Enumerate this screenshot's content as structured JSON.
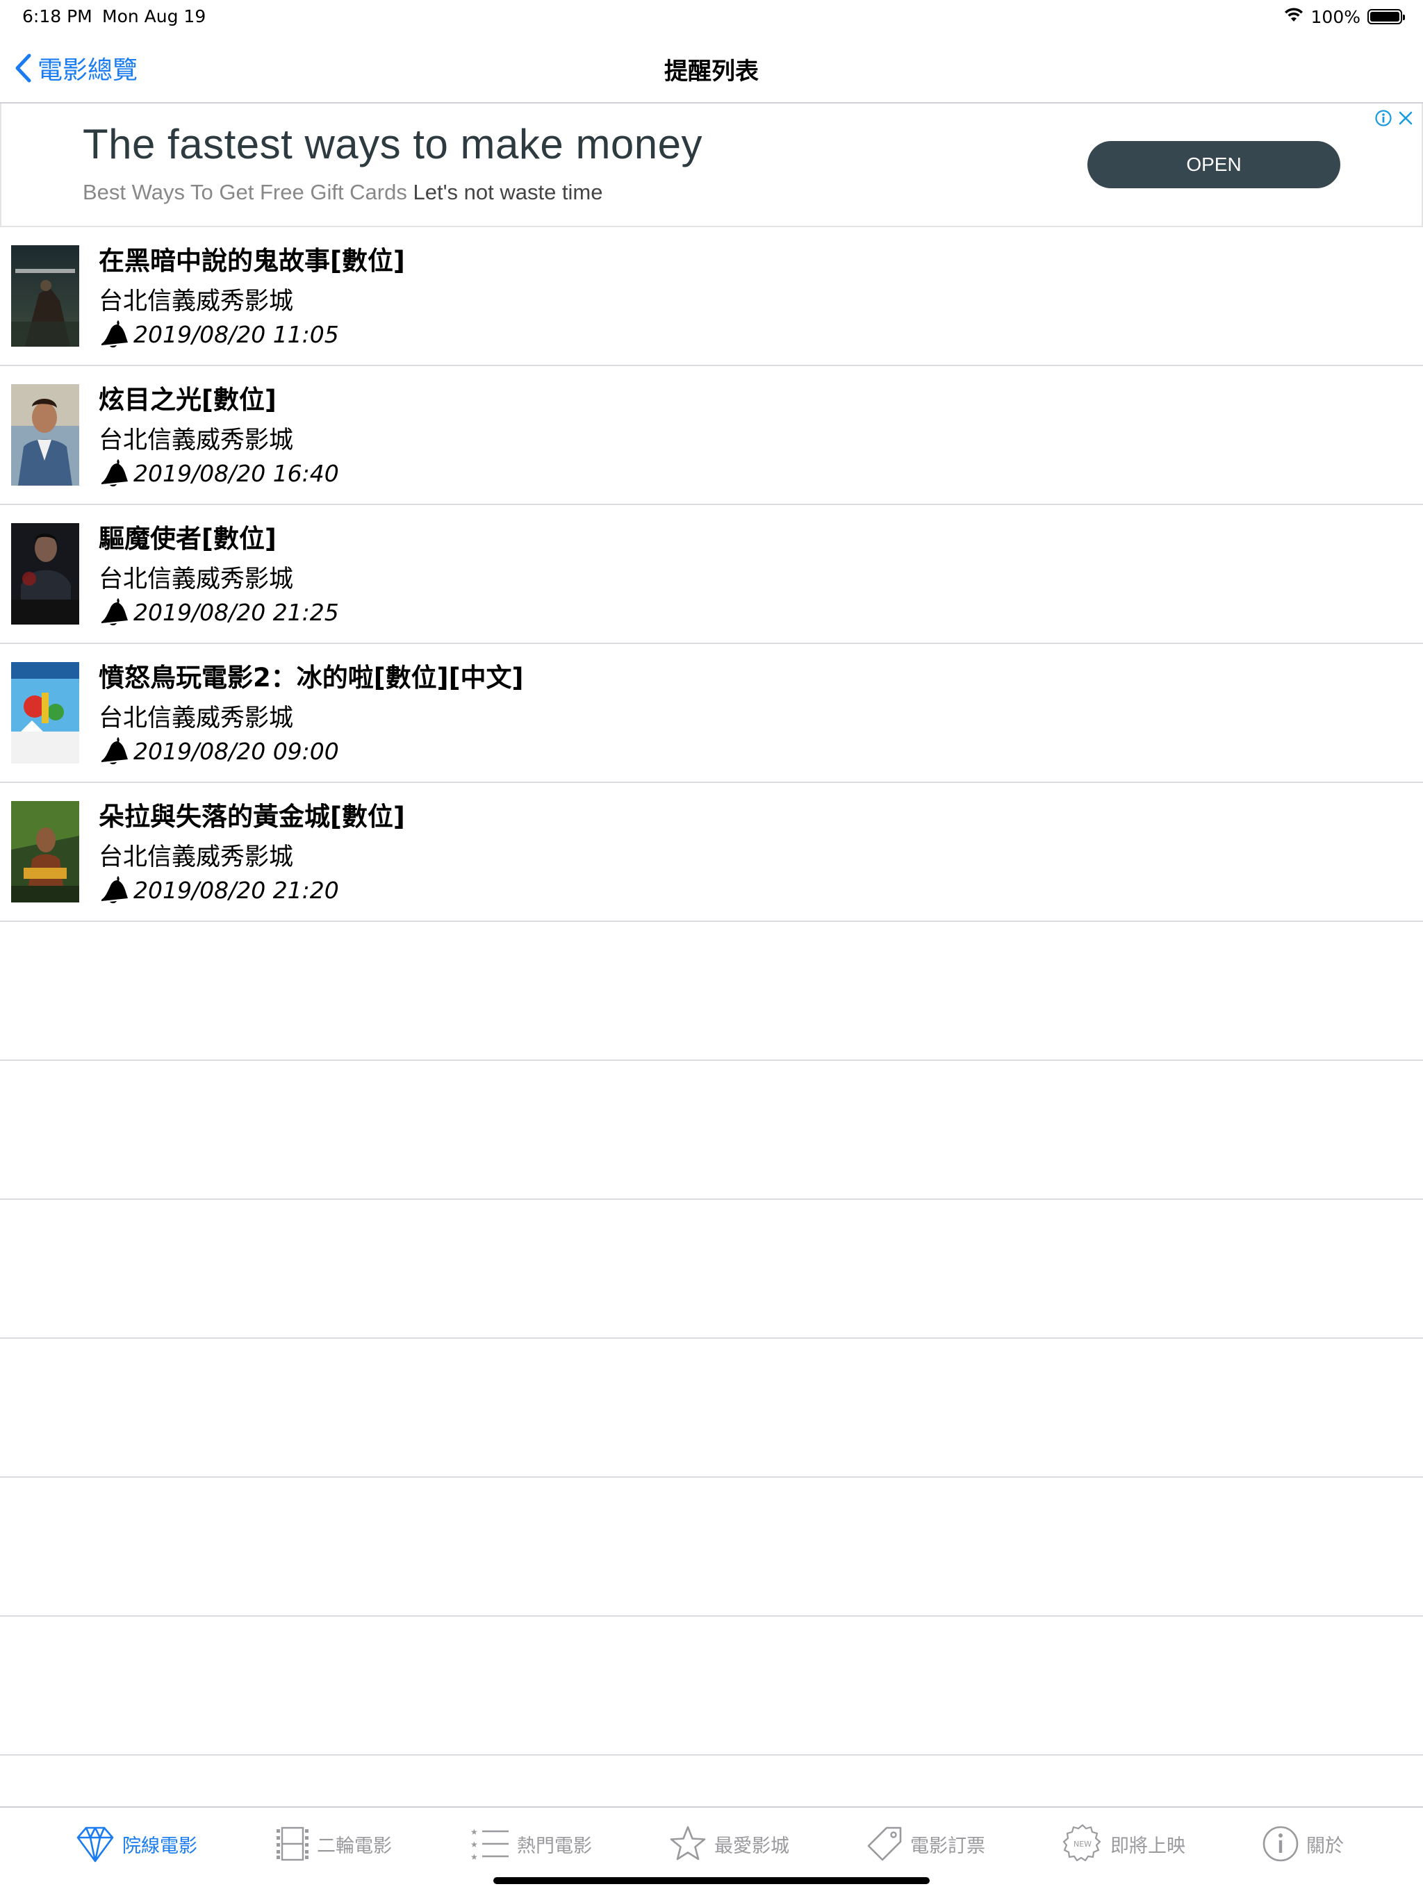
{
  "status_bar": {
    "time": "6:18 PM",
    "date": "Mon Aug 19",
    "battery": "100%"
  },
  "nav": {
    "back_label": "電影總覽",
    "title": "提醒列表"
  },
  "ad": {
    "headline": "The fastest ways to make money",
    "sub_grey": "Best Ways To Get Free Gift Cards",
    "sub_dark": "Let's not waste time",
    "button": "OPEN"
  },
  "reminders": [
    {
      "title": "在黑暗中說的鬼故事[數位]",
      "theater": "台北信義威秀影城",
      "time": "2019/08/20 11:05"
    },
    {
      "title": "炫目之光[數位]",
      "theater": "台北信義威秀影城",
      "time": "2019/08/20 16:40"
    },
    {
      "title": "驅魔使者[數位]",
      "theater": "台北信義威秀影城",
      "time": "2019/08/20 21:25"
    },
    {
      "title": "憤怒鳥玩電影2：冰的啦[數位][中文]",
      "theater": "台北信義威秀影城",
      "time": "2019/08/20 09:00"
    },
    {
      "title": "朵拉與失落的黃金城[數位]",
      "theater": "台北信義威秀影城",
      "time": "2019/08/20 21:20"
    }
  ],
  "tabs": [
    {
      "label": "院線電影",
      "icon": "diamond-icon",
      "active": true
    },
    {
      "label": "二輪電影",
      "icon": "film-strip-icon",
      "active": false
    },
    {
      "label": "熱門電影",
      "icon": "ranked-list-icon",
      "active": false
    },
    {
      "label": "最愛影城",
      "icon": "star-icon",
      "active": false
    },
    {
      "label": "電影訂票",
      "icon": "ticket-tag-icon",
      "active": false
    },
    {
      "label": "即將上映",
      "icon": "new-badge-icon",
      "active": false
    },
    {
      "label": "關於",
      "icon": "info-icon",
      "active": false
    }
  ],
  "colors": {
    "accent": "#1a7cf0",
    "ad_button": "#37474f",
    "ad_text": "#2d3a40",
    "inactive_tab": "#9a9a9e"
  }
}
